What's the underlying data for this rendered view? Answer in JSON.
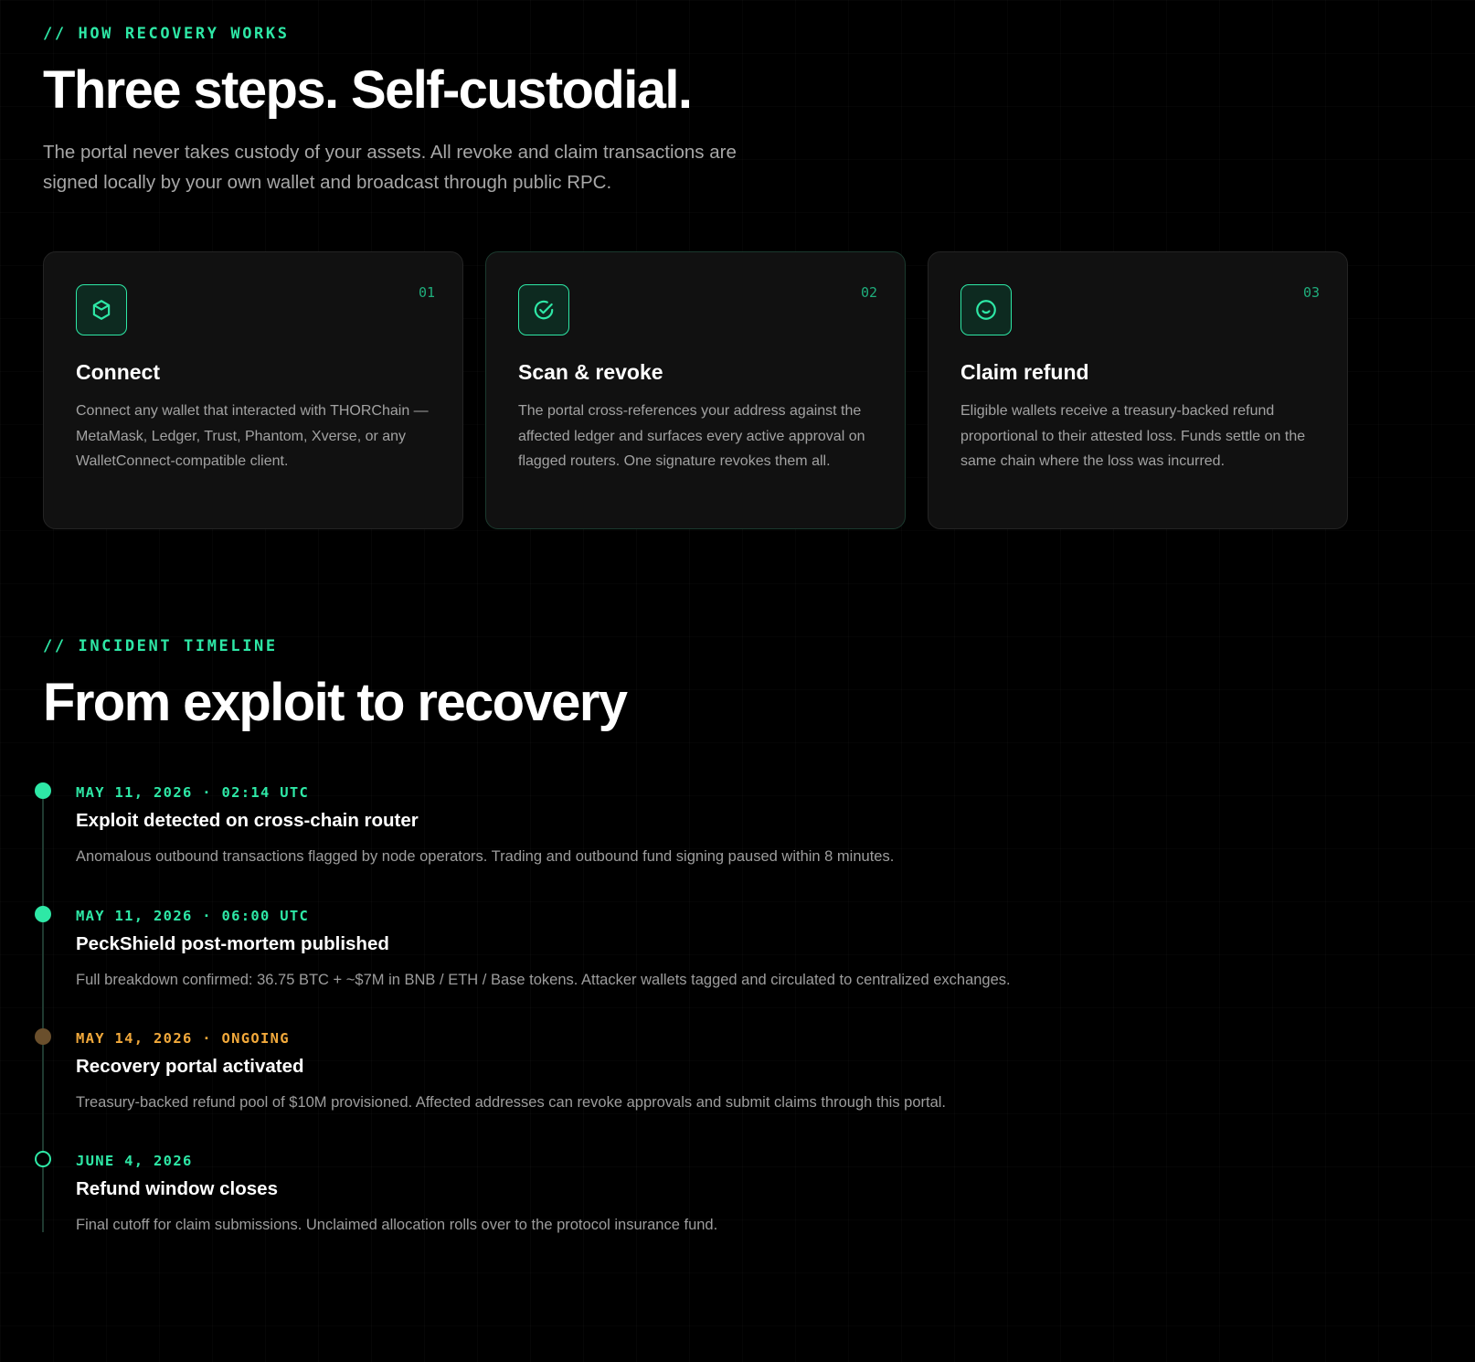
{
  "recovery": {
    "eyebrow": "// HOW RECOVERY WORKS",
    "title": "Three steps. Self-custodial.",
    "lede": "The portal never takes custody of your assets. All revoke and claim transactions are signed locally by your own wallet and broadcast through public RPC.",
    "steps": [
      {
        "number": "01",
        "icon": "cube-icon",
        "title": "Connect",
        "body": "Connect any wallet that interacted with THORChain — MetaMask, Ledger, Trust, Phantom, Xverse, or any WalletConnect-compatible client."
      },
      {
        "number": "02",
        "icon": "check-circle-icon",
        "title": "Scan & revoke",
        "body": "The portal cross-references your address against the affected ledger and surfaces every active approval on flagged routers. One signature revokes them all."
      },
      {
        "number": "03",
        "icon": "smile-circle-icon",
        "title": "Claim refund",
        "body": "Eligible wallets receive a treasury-backed refund proportional to their attested loss. Funds settle on the same chain where the loss was incurred."
      }
    ]
  },
  "timeline": {
    "eyebrow": "// INCIDENT TIMELINE",
    "title": "From exploit to recovery",
    "events": [
      {
        "date": "MAY 11, 2026 · 02:14 UTC",
        "status": "done",
        "title": "Exploit detected on cross-chain router",
        "description": "Anomalous outbound transactions flagged by node operators. Trading and outbound fund signing paused within 8 minutes."
      },
      {
        "date": "MAY 11, 2026 · 06:00 UTC",
        "status": "done",
        "title": "PeckShield post-mortem published",
        "description": "Full breakdown confirmed: 36.75 BTC + ~$7M in BNB / ETH / Base tokens. Attacker wallets tagged and circulated to centralized exchanges."
      },
      {
        "date": "MAY 14, 2026 · ONGOING",
        "status": "ongoing",
        "title": "Recovery portal activated",
        "description": "Treasury-backed refund pool of $10M provisioned. Affected addresses can revoke approvals and submit claims through this portal."
      },
      {
        "date": "JUNE 4, 2026",
        "status": "future",
        "title": "Refund window closes",
        "description": "Final cutoff for claim submissions. Unclaimed allocation rolls over to the protocol insurance fund."
      }
    ]
  },
  "colors": {
    "accent": "#2ee8a6",
    "warning": "#f2a93b",
    "background": "#000000",
    "card": "#111111"
  }
}
